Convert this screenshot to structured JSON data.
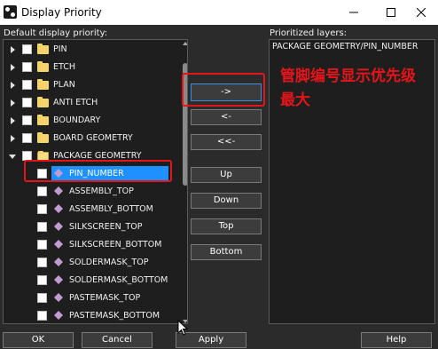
{
  "window": {
    "title": "Display Priority",
    "minimize": "—",
    "maximize": "☐",
    "close": "✕"
  },
  "left_panel": {
    "label": "Default display priority:",
    "rows": [
      {
        "name": "PIN",
        "kind": "folder",
        "expanded": false
      },
      {
        "name": "ETCH",
        "kind": "folder",
        "expanded": false
      },
      {
        "name": "PLAN",
        "kind": "folder",
        "expanded": false
      },
      {
        "name": "ANTI ETCH",
        "kind": "folder",
        "expanded": false
      },
      {
        "name": "BOUNDARY",
        "kind": "folder",
        "expanded": false
      },
      {
        "name": "BOARD GEOMETRY",
        "kind": "folder",
        "expanded": false
      },
      {
        "name": "PACKAGE GEOMETRY",
        "kind": "folder",
        "expanded": true
      },
      {
        "name": "PIN_NUMBER",
        "kind": "layer",
        "selected": true
      },
      {
        "name": "ASSEMBLY_TOP",
        "kind": "layer"
      },
      {
        "name": "ASSEMBLY_BOTTOM",
        "kind": "layer"
      },
      {
        "name": "SILKSCREEN_TOP",
        "kind": "layer"
      },
      {
        "name": "SILKSCREEN_BOTTOM",
        "kind": "layer"
      },
      {
        "name": "SOLDERMASK_TOP",
        "kind": "layer"
      },
      {
        "name": "SOLDERMASK_BOTTOM",
        "kind": "layer"
      },
      {
        "name": "PASTEMASK_TOP",
        "kind": "layer"
      },
      {
        "name": "PASTEMASK_BOTTOM",
        "kind": "layer"
      }
    ]
  },
  "middle_buttons": {
    "move_right": "->",
    "move_left": "<-",
    "move_all_left": "<<-",
    "up": "Up",
    "down": "Down",
    "top": "Top",
    "bottom": "Bottom"
  },
  "right_panel": {
    "label": "Prioritized layers:",
    "items": [
      "PACKAGE GEOMETRY/PIN_NUMBER"
    ]
  },
  "annotation": {
    "text": "管脚编号显示优先级最大",
    "color": "#e3151b"
  },
  "footer": {
    "ok": "OK",
    "cancel": "Cancel",
    "apply": "Apply",
    "help": "Help"
  },
  "colors": {
    "background": "#2b2b2b",
    "panel": "#1e1e1e",
    "selection": "#1e90ff",
    "folder": "#f3d36a",
    "layer_icon": "#c39bd3",
    "annotation_red": "#e3151b"
  }
}
